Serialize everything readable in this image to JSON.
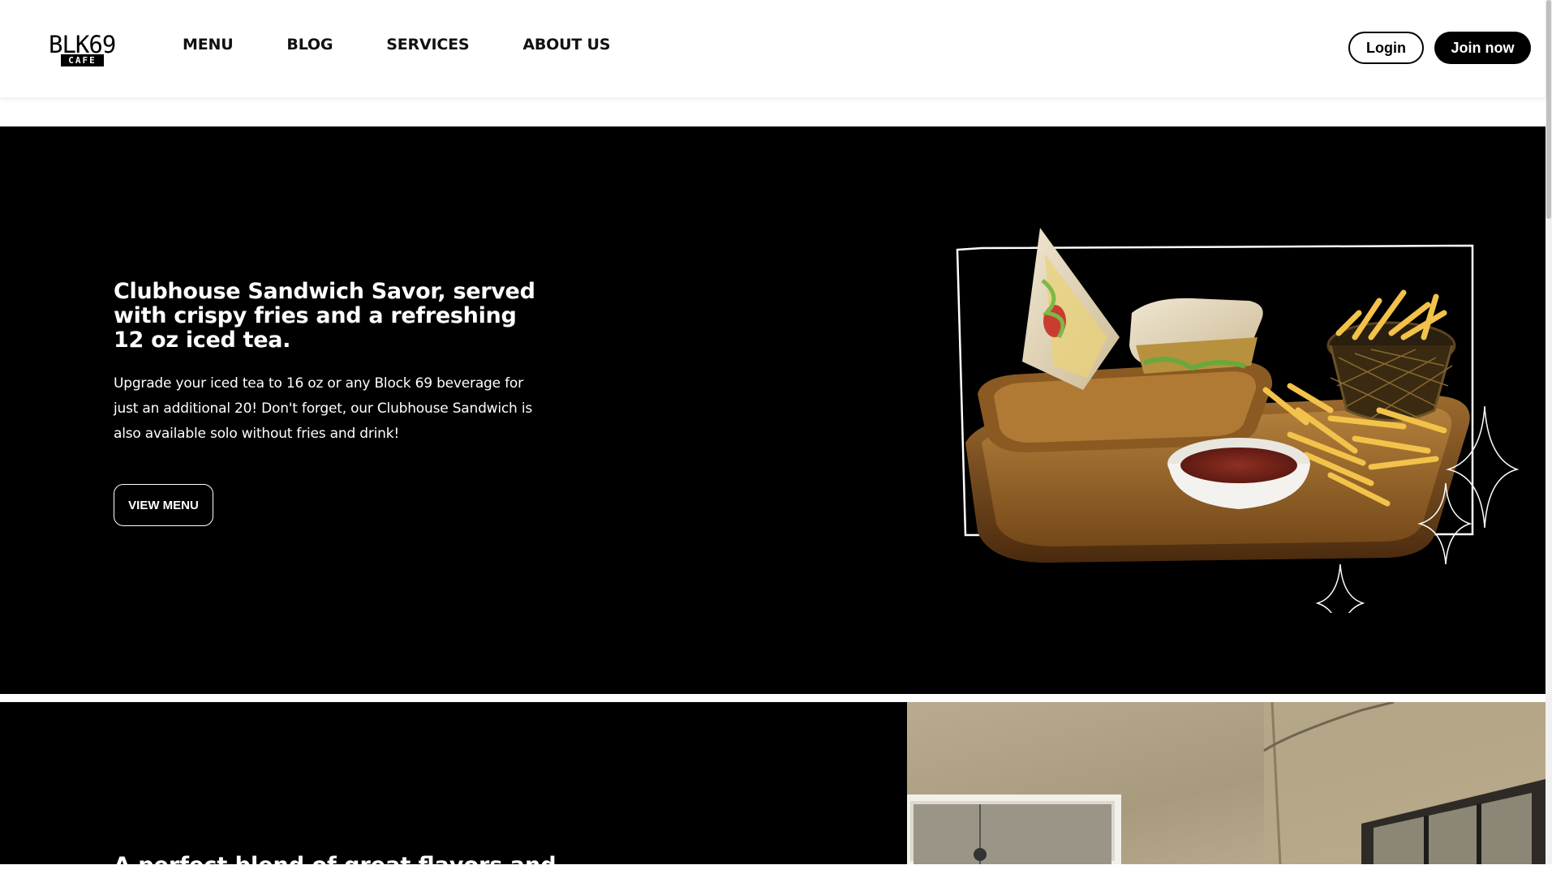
{
  "brand": {
    "logo_text": "BLK69",
    "logo_sub": "CAFE"
  },
  "nav": {
    "items": [
      "MENU",
      "BLOG",
      "SERVICES",
      "ABOUT US"
    ]
  },
  "auth": {
    "login_label": "Login",
    "join_label": "Join now"
  },
  "hero": {
    "title": "Clubhouse Sandwich Savor, served with crispy fries and a refreshing 12 oz iced tea.",
    "description": "Upgrade your iced tea to 16 oz or any Block 69 beverage for just an additional 20! Don't forget, our Clubhouse Sandwich is also available solo without fries and drink!",
    "cta_label": "VIEW MENU"
  },
  "section2": {
    "title": "A perfect blend of great flavors and"
  },
  "colors": {
    "primary": "#000000",
    "background": "#ffffff",
    "accent_text": "#ffffff"
  }
}
